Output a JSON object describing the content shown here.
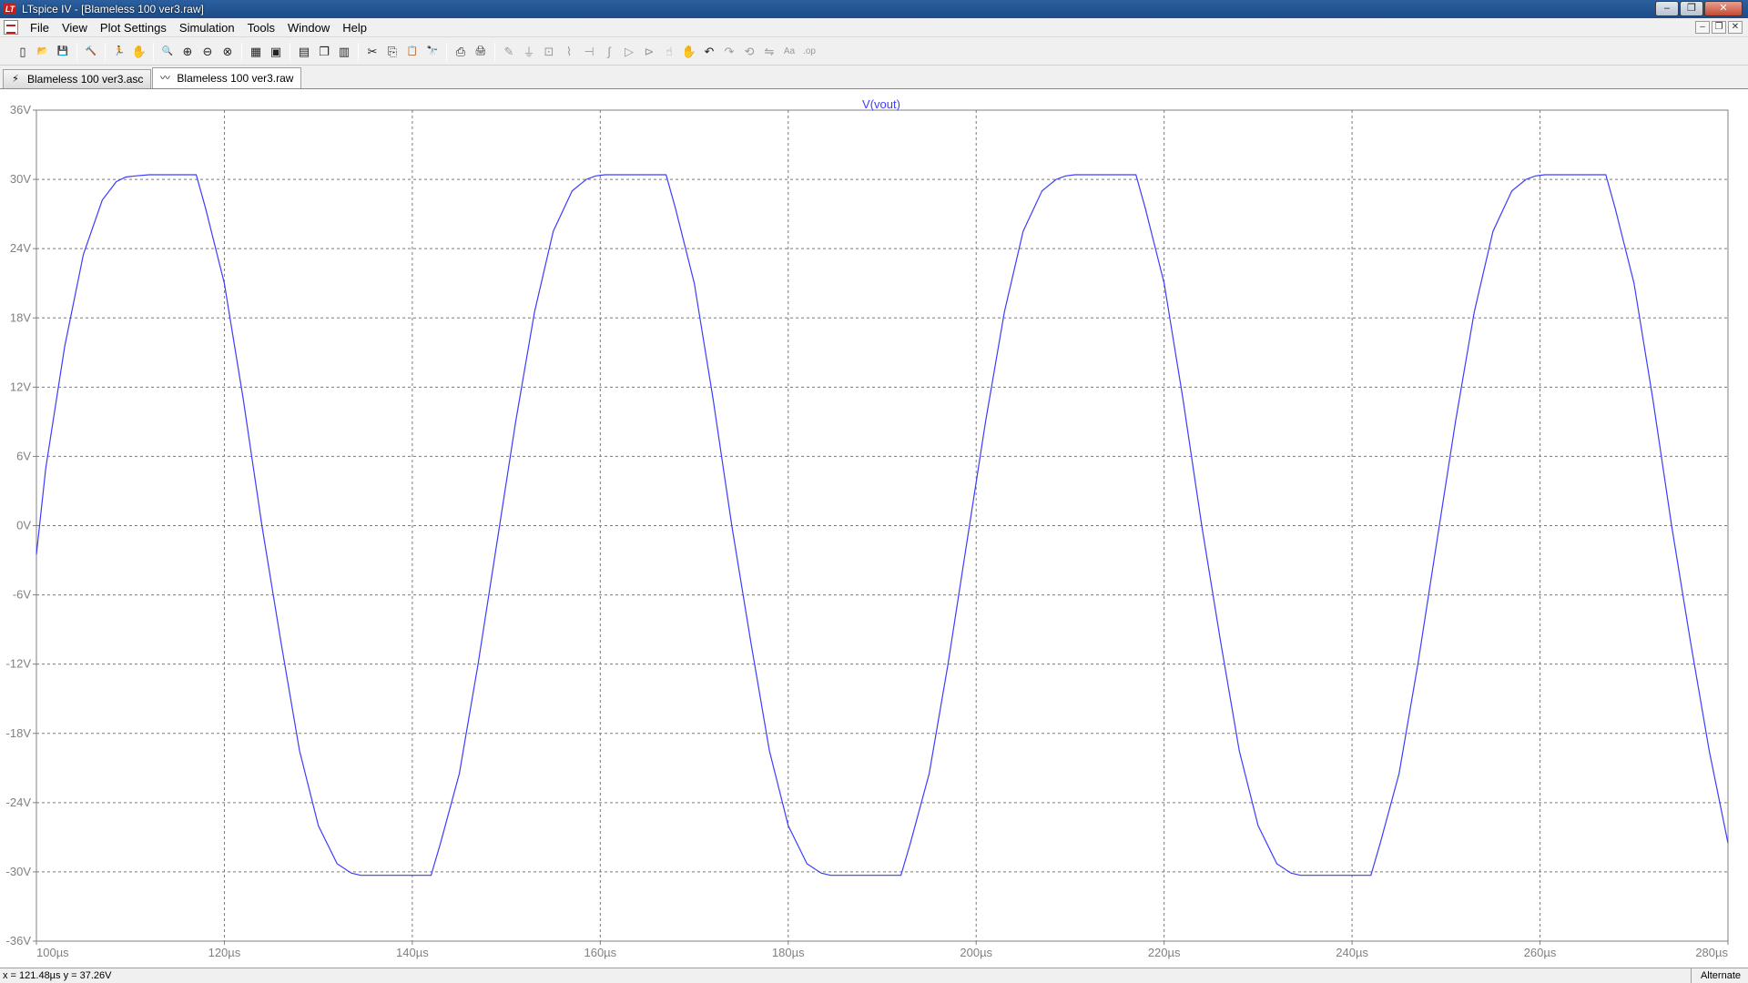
{
  "window": {
    "title": "LTspice IV - [Blameless 100 ver3.raw]",
    "app_icon": "LT",
    "buttons": [
      "–",
      "❐",
      "✕"
    ]
  },
  "menu": {
    "items": [
      "File",
      "View",
      "Plot Settings",
      "Simulation",
      "Tools",
      "Window",
      "Help"
    ],
    "mdi_buttons": [
      "–",
      "❐",
      "✕"
    ]
  },
  "toolbar": {
    "icons": [
      "new-schematic-icon",
      "open-icon",
      "save-icon",
      "|",
      "control-panel-icon",
      "|",
      "run-icon",
      "halt-icon",
      "|",
      "zoom-area-icon",
      "zoom-in-icon",
      "zoom-out-icon",
      "zoom-full-icon",
      "|",
      "autorange-icon",
      "manual-limits-icon",
      "|",
      "tile-horizontal-icon",
      "cascade-icon",
      "tile-vertical-icon",
      "|",
      "cut-icon",
      "copy-icon",
      "paste-icon",
      "find-icon",
      "|",
      "print-setup-icon",
      "print-icon",
      "|",
      "wire-icon",
      "ground-icon",
      "label-icon",
      "resistor-icon",
      "capacitor-icon",
      "inductor-icon",
      "diode-icon",
      "component-icon",
      "move-icon",
      "drag-icon",
      "undo-icon",
      "redo-icon",
      "rotate-icon",
      "mirror-icon",
      "text-icon",
      "spice-directive-icon"
    ]
  },
  "tabs": [
    {
      "label": "Blameless 100 ver3.asc",
      "icon": "schematic-icon",
      "active": false
    },
    {
      "label": "Blameless 100 ver3.raw",
      "icon": "waveform-icon",
      "active": true
    }
  ],
  "chart_data": {
    "type": "line",
    "title": "V(vout)",
    "xlabel": "",
    "ylabel": "",
    "xlim": [
      100,
      280
    ],
    "ylim": [
      -36,
      36
    ],
    "x_ticks": [
      "100µs",
      "120µs",
      "140µs",
      "160µs",
      "180µs",
      "200µs",
      "220µs",
      "240µs",
      "260µs",
      "280µs"
    ],
    "y_ticks": [
      "36V",
      "30V",
      "24V",
      "18V",
      "12V",
      "6V",
      "0V",
      "-6V",
      "-12V",
      "-18V",
      "-24V",
      "-30V",
      "-36V"
    ],
    "grid": true,
    "series": [
      {
        "name": "V(vout)",
        "color": "#3c3cff",
        "x": [
          100,
          101,
          103,
          105,
          107,
          108.5,
          109.5,
          110.5,
          112,
          117,
          118,
          120,
          122,
          124,
          126,
          128,
          130,
          132,
          133.5,
          134.5,
          135.5,
          142,
          143,
          145,
          147,
          149,
          151,
          153,
          155,
          157,
          158.5,
          159.5,
          160.5,
          162,
          167,
          168,
          170,
          172,
          174,
          176,
          178,
          180,
          182,
          183.5,
          184.5,
          185.5,
          192,
          193,
          195,
          197,
          199,
          201,
          203,
          205,
          207,
          208.5,
          209.5,
          210.5,
          212,
          217,
          218,
          220,
          222,
          224,
          226,
          228,
          230,
          232,
          233.5,
          234.5,
          235.5,
          242,
          243,
          245,
          247,
          249,
          251,
          253,
          255,
          257,
          258.5,
          259.5,
          260.5,
          262,
          267,
          268,
          270,
          272,
          274,
          276,
          278,
          280
        ],
        "values": [
          -2.5,
          5,
          15.5,
          23.5,
          28.2,
          29.8,
          30.2,
          30.3,
          30.4,
          30.4,
          27.5,
          21,
          11,
          0,
          -10,
          -19.5,
          -26,
          -29.3,
          -30.1,
          -30.3,
          -30.3,
          -30.3,
          -27.5,
          -21.5,
          -12,
          -1.5,
          9,
          18.5,
          25.5,
          29,
          30,
          30.3,
          30.4,
          30.4,
          30.4,
          27.5,
          21,
          11,
          0,
          -10,
          -19.5,
          -26,
          -29.3,
          -30.1,
          -30.3,
          -30.3,
          -30.3,
          -27.5,
          -21.5,
          -12,
          -1.5,
          9,
          18.5,
          25.5,
          29,
          30,
          30.3,
          30.4,
          30.4,
          30.4,
          27.5,
          21,
          11,
          0,
          -10,
          -19.5,
          -26,
          -29.3,
          -30.1,
          -30.3,
          -30.3,
          -30.3,
          -27.5,
          -21.5,
          -12,
          -1.5,
          9,
          18.5,
          25.5,
          29,
          30,
          30.3,
          30.4,
          30.4,
          30.4,
          27.5,
          21,
          11,
          0,
          -10,
          -19.5,
          -27.5
        ]
      }
    ]
  },
  "status": {
    "coords": "x = 121.48µs   y = 37.26V",
    "mode": "Alternate"
  }
}
